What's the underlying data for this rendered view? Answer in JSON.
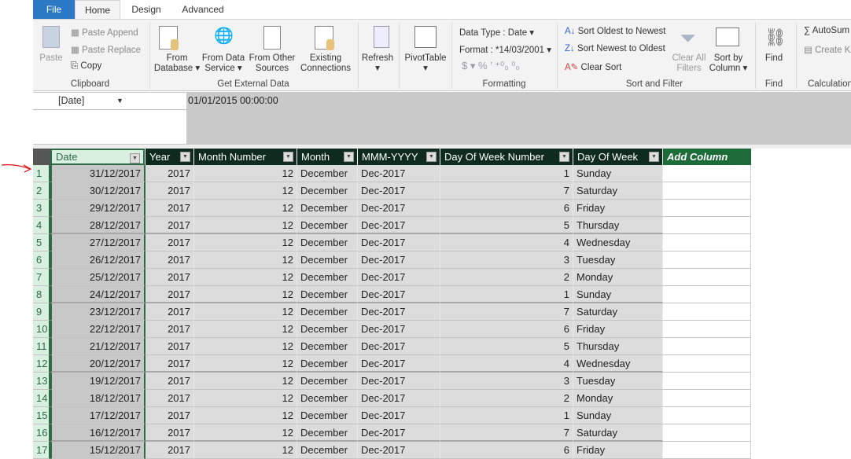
{
  "tabs": {
    "file": "File",
    "home": "Home",
    "design": "Design",
    "advanced": "Advanced"
  },
  "ribbon": {
    "clipboard": {
      "paste": "Paste",
      "paste_append": "Paste Append",
      "paste_replace": "Paste Replace",
      "copy": "Copy",
      "group": "Clipboard"
    },
    "external": {
      "from_database": "From",
      "from_database2": "Database",
      "from_service": "From Data",
      "from_service2": "Service",
      "from_other": "From Other",
      "from_other2": "Sources",
      "existing": "Existing",
      "existing2": "Connections",
      "group": "Get External Data"
    },
    "refresh": "Refresh",
    "pivottable": "PivotTable",
    "formatting": {
      "data_type": "Data Type : Date",
      "format": "Format : *14/03/2001",
      "group": "Formatting"
    },
    "sort": {
      "oldest": "Sort Oldest to Newest",
      "newest": "Sort Newest to Oldest",
      "clear": "Clear Sort",
      "clear_filters": "Clear All",
      "clear_filters2": "Filters",
      "sort_by": "Sort by",
      "sort_by2": "Column",
      "group": "Sort and Filter"
    },
    "find": {
      "label": "Find",
      "group": "Find"
    },
    "calc": {
      "autosum": "AutoSum",
      "create_kpi": "Create K",
      "group": "Calculation"
    }
  },
  "formula_bar": {
    "name_box": "[Date]",
    "value": "01/01/2015 00:00:00"
  },
  "table": {
    "columns": [
      "Date",
      "Year",
      "Month Number",
      "Month",
      "MMM-YYYY",
      "Day Of Week Number",
      "Day Of Week"
    ],
    "add_column": "Add Column",
    "rows": [
      [
        "31/12/2017",
        "2017",
        "12",
        "December",
        "Dec-2017",
        "1",
        "Sunday"
      ],
      [
        "30/12/2017",
        "2017",
        "12",
        "December",
        "Dec-2017",
        "7",
        "Saturday"
      ],
      [
        "29/12/2017",
        "2017",
        "12",
        "December",
        "Dec-2017",
        "6",
        "Friday"
      ],
      [
        "28/12/2017",
        "2017",
        "12",
        "December",
        "Dec-2017",
        "5",
        "Thursday"
      ],
      [
        "27/12/2017",
        "2017",
        "12",
        "December",
        "Dec-2017",
        "4",
        "Wednesday"
      ],
      [
        "26/12/2017",
        "2017",
        "12",
        "December",
        "Dec-2017",
        "3",
        "Tuesday"
      ],
      [
        "25/12/2017",
        "2017",
        "12",
        "December",
        "Dec-2017",
        "2",
        "Monday"
      ],
      [
        "24/12/2017",
        "2017",
        "12",
        "December",
        "Dec-2017",
        "1",
        "Sunday"
      ],
      [
        "23/12/2017",
        "2017",
        "12",
        "December",
        "Dec-2017",
        "7",
        "Saturday"
      ],
      [
        "22/12/2017",
        "2017",
        "12",
        "December",
        "Dec-2017",
        "6",
        "Friday"
      ],
      [
        "21/12/2017",
        "2017",
        "12",
        "December",
        "Dec-2017",
        "5",
        "Thursday"
      ],
      [
        "20/12/2017",
        "2017",
        "12",
        "December",
        "Dec-2017",
        "4",
        "Wednesday"
      ],
      [
        "19/12/2017",
        "2017",
        "12",
        "December",
        "Dec-2017",
        "3",
        "Tuesday"
      ],
      [
        "18/12/2017",
        "2017",
        "12",
        "December",
        "Dec-2017",
        "2",
        "Monday"
      ],
      [
        "17/12/2017",
        "2017",
        "12",
        "December",
        "Dec-2017",
        "1",
        "Sunday"
      ],
      [
        "16/12/2017",
        "2017",
        "12",
        "December",
        "Dec-2017",
        "7",
        "Saturday"
      ],
      [
        "15/12/2017",
        "2017",
        "12",
        "December",
        "Dec-2017",
        "6",
        "Friday"
      ]
    ]
  }
}
